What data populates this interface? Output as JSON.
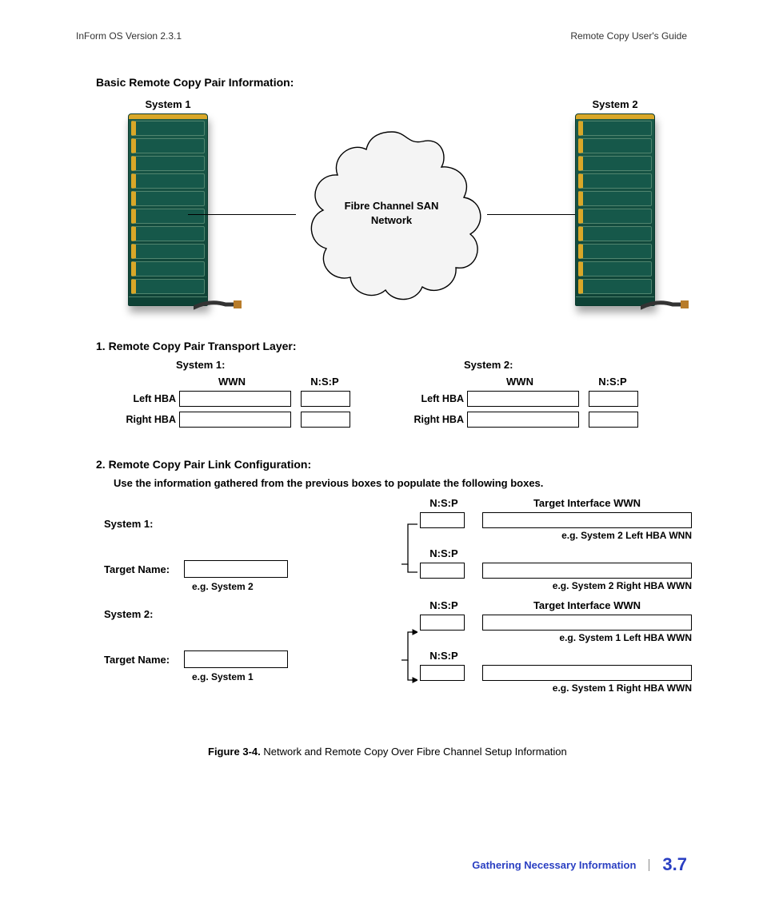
{
  "header": {
    "left": "InForm OS Version 2.3.1",
    "right": "Remote Copy User's Guide"
  },
  "section_basic_title": "Basic Remote Copy Pair Information:",
  "diagram": {
    "sys1_label": "System 1",
    "sys2_label": "System 2",
    "cloud_line1": "Fibre Channel SAN",
    "cloud_line2": "Network"
  },
  "transport": {
    "title": "1. Remote Copy Pair Transport Layer:",
    "systems": [
      {
        "name": "System 1:",
        "col_wwn": "WWN",
        "col_nsp": "N:S:P",
        "rows": [
          {
            "label": "Left HBA",
            "wwn": "",
            "nsp": ""
          },
          {
            "label": "Right HBA",
            "wwn": "",
            "nsp": ""
          }
        ]
      },
      {
        "name": "System 2:",
        "col_wwn": "WWN",
        "col_nsp": "N:S:P",
        "rows": [
          {
            "label": "Left HBA",
            "wwn": "",
            "nsp": ""
          },
          {
            "label": "Right HBA",
            "wwn": "",
            "nsp": ""
          }
        ]
      }
    ]
  },
  "linkcfg": {
    "title": "2. Remote Copy Pair Link Configuration:",
    "instr": "Use the information gathered from the previous boxes to populate the following boxes.",
    "left": {
      "sys1": "System 1:",
      "target_label": "Target Name:",
      "eg_sys2": "e.g. System 2",
      "sys2": "System 2:",
      "eg_sys1": "e.g. System 1",
      "target1_value": "",
      "target2_value": ""
    },
    "right": {
      "hdr_nsp": "N:S:P",
      "hdr_wwn": "Target Interface WWN",
      "blocks": [
        {
          "nsp": "",
          "wwn": "",
          "note": "e.g. System 2 Left HBA WNN"
        },
        {
          "nsp": "",
          "wwn": "",
          "note": "e.g. System 2 Right HBA WWN"
        },
        {
          "nsp": "",
          "wwn": "",
          "note": "e.g. System 1 Left HBA WWN"
        },
        {
          "nsp": "",
          "wwn": "",
          "note": "e.g. System 1 Right HBA WWN"
        }
      ],
      "hdr_nsp2": "N:S:P",
      "hdr_wwn2": "Target Interface WWN"
    }
  },
  "figure": {
    "num": "Figure 3-4.",
    "text": " Network and Remote Copy Over Fibre Channel Setup Information"
  },
  "footer": {
    "section": "Gathering Necessary Information",
    "page": "3.7"
  }
}
